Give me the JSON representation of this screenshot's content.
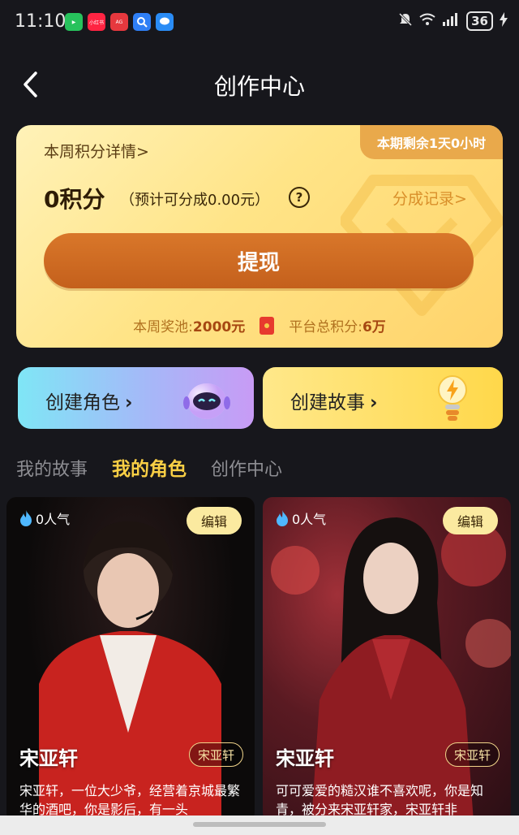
{
  "status_bar": {
    "time": "11:10",
    "battery": "36",
    "apps": [
      {
        "name": "video-app-icon",
        "color": "#27c25c",
        "label": "▶"
      },
      {
        "name": "xiaohongshu-icon",
        "color": "#ff2442",
        "label": "小红书"
      },
      {
        "name": "app-gallery-icon",
        "color": "#e6383e",
        "label": "App Gallery"
      },
      {
        "name": "search-app-icon",
        "color": "#2f7ff5",
        "label": "🔍"
      },
      {
        "name": "message-app-icon",
        "color": "#2a8cf5",
        "label": "💬"
      }
    ]
  },
  "header": {
    "title": "创作中心"
  },
  "points_card": {
    "weekly_details": "本周积分详情>",
    "remaining_badge": "本期剩余1天0小时",
    "points": "0积分",
    "estimate": "（预计可分成0.00元）",
    "help": "?",
    "share_record": "分成记录>",
    "withdraw": "提现",
    "pool_label": "本周奖池:",
    "pool_value": "2000元",
    "total_label": "平台总积分:",
    "total_value": "6万"
  },
  "create": {
    "role": "创建角色",
    "story": "创建故事",
    "chevron": "›"
  },
  "tabs": [
    {
      "label": "我的故事",
      "active": false
    },
    {
      "label": "我的角色",
      "active": true
    },
    {
      "label": "创作中心",
      "active": false
    }
  ],
  "roles": [
    {
      "popularity": "0人气",
      "edit": "编辑",
      "name": "宋亚轩",
      "tag": "宋亚轩",
      "description": "宋亚轩，一位大少爷，经营着京城最繁华的酒吧，你是影后，有一头"
    },
    {
      "popularity": "0人气",
      "edit": "编辑",
      "name": "宋亚轩",
      "tag": "宋亚轩",
      "description": "可可爱爱的糙汉谁不喜欢呢，你是知青，被分来宋亚轩家，宋亚轩非"
    }
  ],
  "colors": {
    "accent_tab": "#f9cf45",
    "withdraw_button": "#d06a22",
    "background": "#17171c"
  }
}
